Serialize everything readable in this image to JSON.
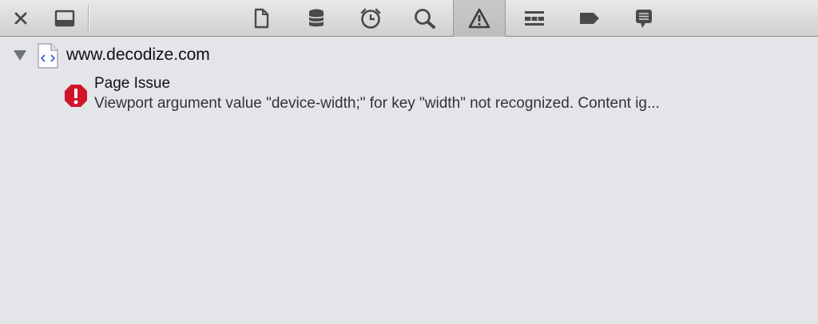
{
  "toolbar": {
    "buttons": [
      {
        "icon": "close-icon"
      },
      {
        "icon": "dock-icon"
      },
      {
        "icon": "resources-document-icon"
      },
      {
        "icon": "storage-database-icon"
      },
      {
        "icon": "timeline-clock-icon"
      },
      {
        "icon": "search-icon"
      },
      {
        "icon": "issues-warning-icon",
        "active": true
      },
      {
        "icon": "debugger-icon"
      },
      {
        "icon": "breakpoints-icon"
      },
      {
        "icon": "log-icon"
      }
    ]
  },
  "tree": {
    "site": {
      "label": "www.decodize.com",
      "icon": "html-file-icon",
      "expanded": true
    },
    "issues": [
      {
        "icon": "error-icon",
        "title": "Page Issue",
        "message": "Viewport argument value \"device-width;\" for key \"width\" not recognized. Content ig..."
      }
    ]
  },
  "colors": {
    "background": "#e3e5e9",
    "error": "#d0152a",
    "icon": "#555555"
  }
}
